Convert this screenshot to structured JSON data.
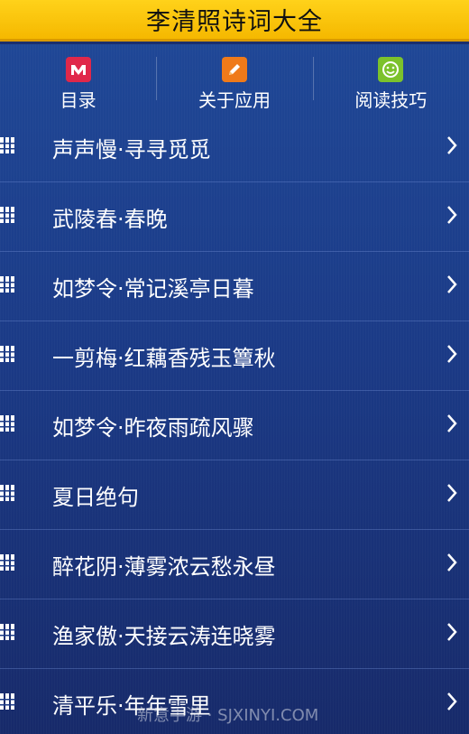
{
  "header": {
    "title": "李清照诗词大全"
  },
  "nav": [
    {
      "label": "目录",
      "icon": "menu-m-icon",
      "color": "#e0284a"
    },
    {
      "label": "关于应用",
      "icon": "pencil-icon",
      "color": "#ef7a1a"
    },
    {
      "label": "阅读技巧",
      "icon": "smiley-icon",
      "color": "#7cc22c"
    }
  ],
  "list": {
    "items": [
      {
        "label": "声声慢·寻寻觅觅"
      },
      {
        "label": "武陵春·春晚"
      },
      {
        "label": "如梦令·常记溪亭日暮"
      },
      {
        "label": "一剪梅·红藕香残玉簟秋"
      },
      {
        "label": "如梦令·昨夜雨疏风骤"
      },
      {
        "label": "夏日绝句"
      },
      {
        "label": "醉花阴·薄雾浓云愁永昼"
      },
      {
        "label": "渔家傲·天接云涛连晓雾"
      },
      {
        "label": "清平乐·年年雪里"
      }
    ]
  },
  "watermark": "新意手游 · SJXINYI.COM",
  "colors": {
    "header_bg": "#ffd21a",
    "list_bg": "#1b3a86",
    "text": "#ffffff"
  }
}
